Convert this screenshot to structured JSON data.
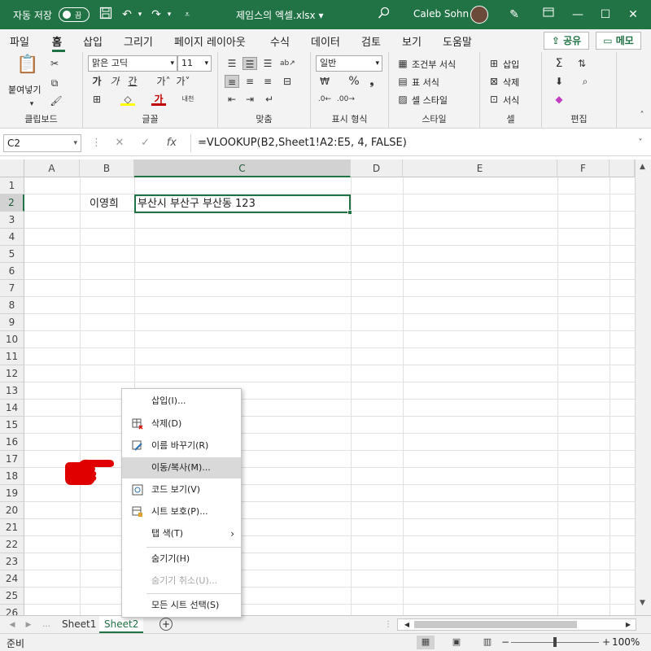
{
  "titlebar": {
    "autosave_label": "자동 저장",
    "toggle_label": "끔",
    "filename": "제임스의 엑셀.xlsx",
    "user": "Caleb Sohn"
  },
  "tabs": [
    "파일",
    "홈",
    "삽입",
    "그리기",
    "페이지 레이아웃",
    "수식",
    "데이터",
    "검토",
    "보기",
    "도움말"
  ],
  "share_label": "공유",
  "memo_label": "메모",
  "ribbon": {
    "clipboard": {
      "paste": "붙여넣기",
      "label": "클립보드"
    },
    "font": {
      "name": "맑은 고딕",
      "size": "11",
      "bold": "가",
      "italic": "가",
      "underline": "간",
      "label": "글꼴"
    },
    "align": {
      "label": "맞춤"
    },
    "number": {
      "format": "일반",
      "label": "표시 형식"
    },
    "styles": {
      "conditional": "조건부 서식",
      "table": "표 서식",
      "cell": "셀 스타일",
      "label": "스타일"
    },
    "cells": {
      "insert": "삽입",
      "delete": "삭제",
      "format": "서식",
      "label": "셀"
    },
    "editing": {
      "label": "편집"
    }
  },
  "formula_bar": {
    "name_box": "C2",
    "formula": "=VLOOKUP(B2,Sheet1!A2:E5, 4, FALSE)"
  },
  "columns": [
    "A",
    "B",
    "C",
    "D",
    "E",
    "F"
  ],
  "rows": [
    "1",
    "2",
    "3",
    "4",
    "5",
    "6",
    "7",
    "8",
    "9",
    "10",
    "11",
    "12",
    "13",
    "14",
    "15",
    "16",
    "17",
    "18",
    "19",
    "20",
    "21",
    "22",
    "23",
    "24",
    "25",
    "26"
  ],
  "cells": {
    "B2": "이영희",
    "C2": "부산시 부산구 부산동 123"
  },
  "sheets": [
    "Sheet1",
    "Sheet2"
  ],
  "active_sheet": "Sheet2",
  "status": {
    "ready": "준비",
    "zoom": "100%"
  },
  "context_menu": [
    {
      "label": "삽입(I)...",
      "icon": ""
    },
    {
      "label": "삭제(D)",
      "icon": "delete-sheet-icon"
    },
    {
      "label": "이름 바꾸기(R)",
      "icon": "rename-sheet-icon"
    },
    {
      "label": "이동/복사(M)...",
      "icon": "",
      "state": "hover"
    },
    {
      "label": "코드 보기(V)",
      "icon": "view-code-icon"
    },
    {
      "label": "시트 보호(P)...",
      "icon": "protect-sheet-icon"
    },
    {
      "label": "탭 색(T)",
      "icon": ""
    },
    {
      "label": "숨기기(H)",
      "icon": ""
    },
    {
      "label": "숨기기 취소(U)...",
      "icon": "",
      "state": "disabled"
    },
    {
      "label": "모든 시트 선택(S)",
      "icon": ""
    }
  ],
  "colors": {
    "brand": "#217346",
    "pointer": "#e00000"
  }
}
